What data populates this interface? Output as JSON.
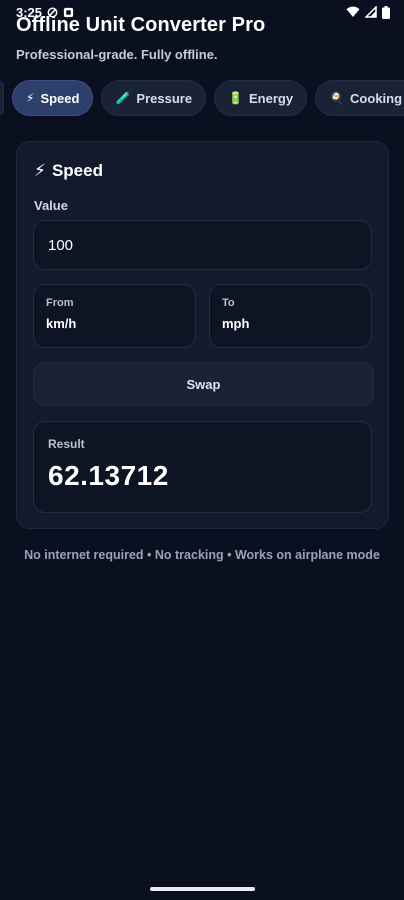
{
  "status_bar": {
    "time": "3:25",
    "left_icons": [
      "do-not-disturb-icon",
      "notification-icon"
    ],
    "right_icons": [
      "wifi-icon",
      "signal-icon",
      "battery-icon"
    ]
  },
  "header": {
    "title": "Offline Unit Converter Pro",
    "subtitle": "Professional-grade. Fully offline."
  },
  "tabs": [
    {
      "label": "Speed",
      "icon": "⚡",
      "active": true
    },
    {
      "label": "Pressure",
      "icon": "🧪",
      "active": false
    },
    {
      "label": "Energy",
      "icon": "🔋",
      "active": false
    },
    {
      "label": "Cooking Un",
      "icon": "🍳",
      "active": false
    }
  ],
  "converter": {
    "title_icon": "⚡",
    "title": "Speed",
    "value_label": "Value",
    "value": "100",
    "from_label": "From",
    "from_unit": "km/h",
    "to_label": "To",
    "to_unit": "mph",
    "swap_label": "Swap",
    "result_label": "Result",
    "result_value": "62.13712"
  },
  "footer": {
    "note": "No internet required • No tracking • Works on airplane mode"
  },
  "colors": {
    "background": "#0b1020",
    "card": "#121a2c",
    "active_tab": "#2d3f6b",
    "accent_bolt": "#f5c518"
  }
}
